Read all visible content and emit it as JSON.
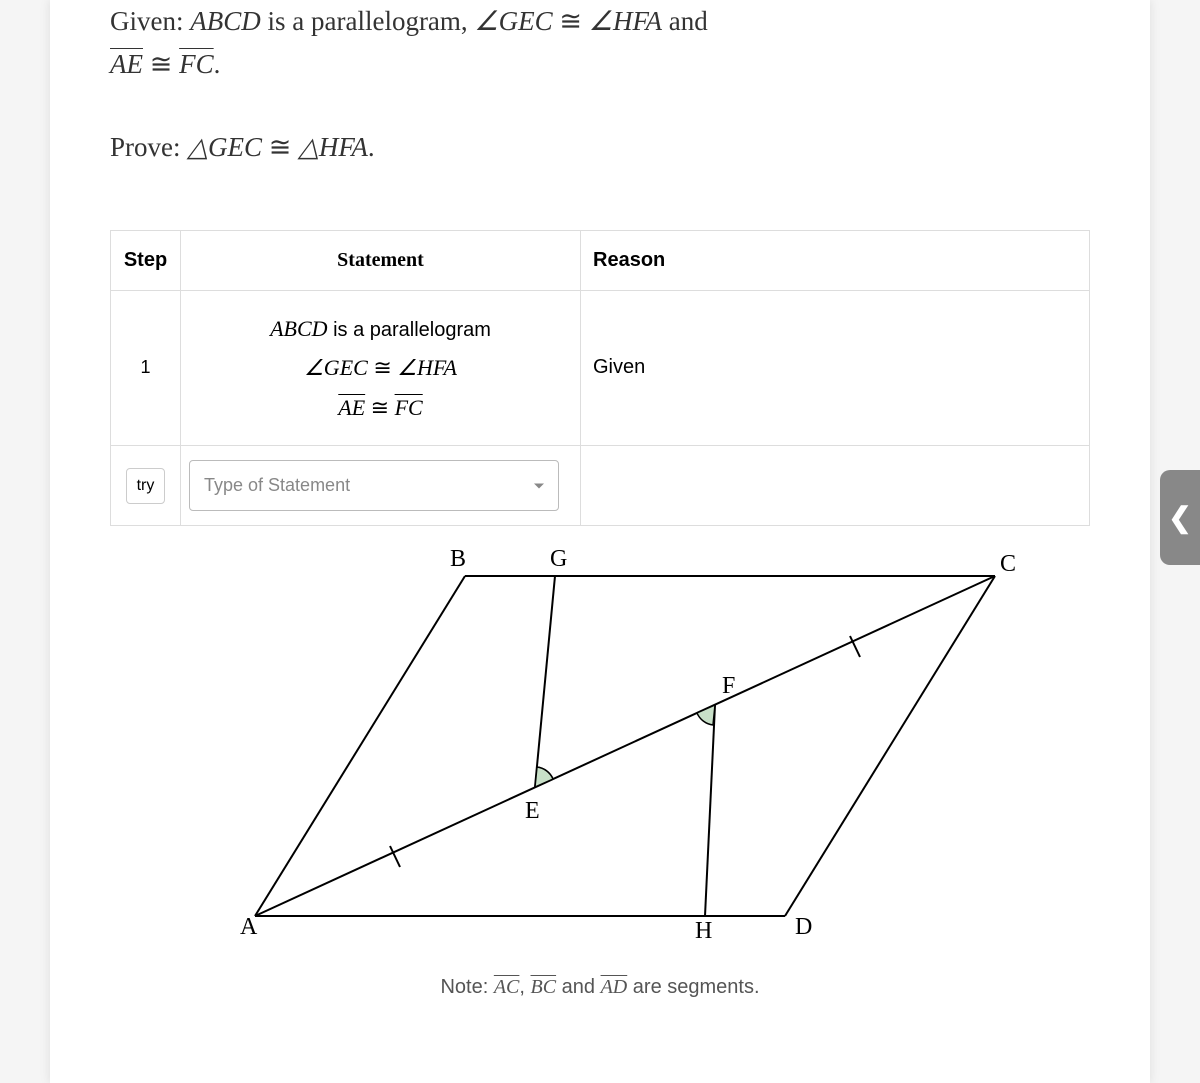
{
  "problem": {
    "given_prefix": "Given: ",
    "given_abcd": "ABCD",
    "given_text1": " is a parallelogram, ",
    "given_angle1": "∠GEC",
    "given_cong": " ≅ ",
    "given_angle2": "∠HFA",
    "given_and": " and",
    "given_seg1": "AE",
    "given_seg2": "FC",
    "given_period": ".",
    "prove_prefix": "Prove: ",
    "prove_tri1": "△GEC",
    "prove_cong": " ≅ ",
    "prove_tri2": "△HFA",
    "prove_period": "."
  },
  "table": {
    "headers": {
      "step": "Step",
      "statement": "Statement",
      "reason": "Reason"
    },
    "rows": [
      {
        "step": "1",
        "statement": {
          "line1_abcd": "ABCD",
          "line1_rest": " is a parallelogram",
          "line2_a1": "∠GEC",
          "line2_cong": " ≅ ",
          "line2_a2": "∠HFA",
          "line3_s1": "AE",
          "line3_cong": " ≅ ",
          "line3_s2": "FC"
        },
        "reason": "Given"
      }
    ],
    "try_label": "try",
    "dropdown_placeholder": "Type of Statement"
  },
  "figure": {
    "labels": {
      "A": "A",
      "B": "B",
      "C": "C",
      "D": "D",
      "E": "E",
      "F": "F",
      "G": "G",
      "H": "H"
    }
  },
  "note": {
    "prefix": "Note: ",
    "seg1": "AC",
    "comma": ", ",
    "seg2": "BC",
    "and": " and ",
    "seg3": "AD",
    "suffix": " are segments."
  },
  "side_tab": "❮"
}
